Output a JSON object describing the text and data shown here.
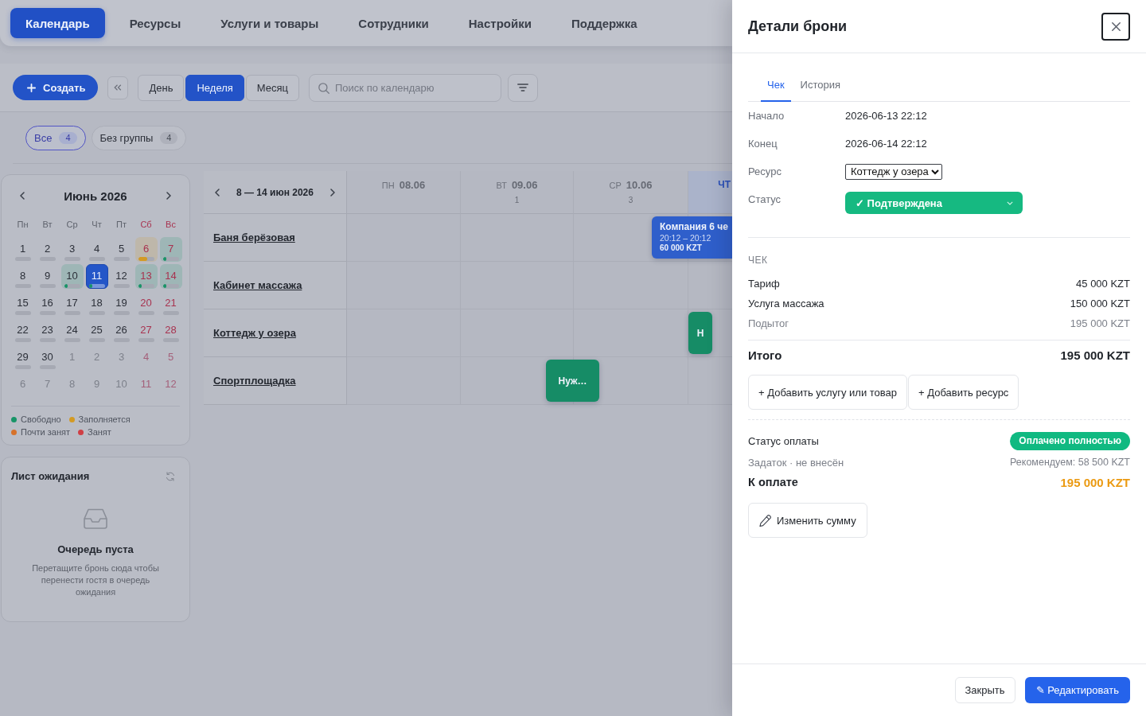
{
  "nav": {
    "tabs": [
      {
        "label": "Календарь",
        "selected": true
      },
      {
        "label": "Ресурсы",
        "selected": false
      },
      {
        "label": "Услуги и товары",
        "selected": false
      },
      {
        "label": "Сотрудники",
        "selected": false
      },
      {
        "label": "Настройки",
        "selected": false
      },
      {
        "label": "Поддержка",
        "selected": false
      }
    ]
  },
  "toolbar": {
    "create_button": "Создать",
    "views": [
      {
        "label": "День",
        "selected": false
      },
      {
        "label": "Неделя",
        "selected": true
      },
      {
        "label": "Месяц",
        "selected": false
      }
    ],
    "search": {
      "placeholder": "Поиск по календарю"
    }
  },
  "groups": [
    {
      "label": "Все",
      "count": "4",
      "selected": true
    },
    {
      "label": "Без группы",
      "count": "4",
      "selected": false
    }
  ],
  "mini_calendar": {
    "title": "Июнь 2026",
    "weekdays": [
      "Пн",
      "Вт",
      "Ср",
      "Чт",
      "Пт",
      "Сб",
      "Вс"
    ],
    "days": [
      {
        "label": "1",
        "in_month": true,
        "selected": false
      },
      {
        "label": "2",
        "in_month": true,
        "selected": false
      },
      {
        "label": "3",
        "in_month": true,
        "selected": false
      },
      {
        "label": "4",
        "in_month": true,
        "selected": false
      },
      {
        "label": "5",
        "in_month": true,
        "selected": false
      },
      {
        "label": "6",
        "in_month": true,
        "selected": false,
        "level": 0.55,
        "color": "#d39a23"
      },
      {
        "label": "7",
        "in_month": true,
        "selected": false,
        "level": 0.2,
        "color": "#179467"
      },
      {
        "label": "8",
        "in_month": true,
        "selected": false
      },
      {
        "label": "9",
        "in_month": true,
        "selected": false
      },
      {
        "label": "10",
        "in_month": true,
        "selected": false,
        "level": 0.2,
        "color": "#179467"
      },
      {
        "label": "11",
        "in_month": true,
        "selected": true,
        "level": 0.2,
        "color": "#179467"
      },
      {
        "label": "12",
        "in_month": true,
        "selected": false
      },
      {
        "label": "13",
        "in_month": true,
        "selected": false,
        "level": 0.2,
        "color": "#179467"
      },
      {
        "label": "14",
        "in_month": true,
        "selected": false,
        "level": 0.2,
        "color": "#179467"
      },
      {
        "label": "15",
        "in_month": true,
        "selected": false
      },
      {
        "label": "16",
        "in_month": true,
        "selected": false
      },
      {
        "label": "17",
        "in_month": true,
        "selected": false
      },
      {
        "label": "18",
        "in_month": true,
        "selected": false
      },
      {
        "label": "19",
        "in_month": true,
        "selected": false
      },
      {
        "label": "20",
        "in_month": true,
        "selected": false
      },
      {
        "label": "21",
        "in_month": true,
        "selected": false
      },
      {
        "label": "22",
        "in_month": true,
        "selected": false
      },
      {
        "label": "23",
        "in_month": true,
        "selected": false
      },
      {
        "label": "24",
        "in_month": true,
        "selected": false
      },
      {
        "label": "25",
        "in_month": true,
        "selected": false
      },
      {
        "label": "26",
        "in_month": true,
        "selected": false
      },
      {
        "label": "27",
        "in_month": true,
        "selected": false
      },
      {
        "label": "28",
        "in_month": true,
        "selected": false
      },
      {
        "label": "29",
        "in_month": true,
        "selected": false
      },
      {
        "label": "30",
        "in_month": true,
        "selected": false
      },
      {
        "label": "1",
        "in_month": false,
        "selected": false
      },
      {
        "label": "2",
        "in_month": false,
        "selected": false
      },
      {
        "label": "3",
        "in_month": false,
        "selected": false
      },
      {
        "label": "4",
        "in_month": false,
        "selected": false
      },
      {
        "label": "5",
        "in_month": false,
        "selected": false
      },
      {
        "label": "6",
        "in_month": false,
        "selected": false
      },
      {
        "label": "7",
        "in_month": false,
        "selected": false
      },
      {
        "label": "8",
        "in_month": false,
        "selected": false
      },
      {
        "label": "9",
        "in_month": false,
        "selected": false
      },
      {
        "label": "10",
        "in_month": false,
        "selected": false
      },
      {
        "label": "11",
        "in_month": false,
        "selected": false
      },
      {
        "label": "12",
        "in_month": false,
        "selected": false
      }
    ],
    "legend": [
      {
        "label": "Свободно",
        "color": "#179467"
      },
      {
        "label": "Заполняется",
        "color": "#d39a23"
      },
      {
        "label": "Почти занят",
        "color": "#d6722b"
      },
      {
        "label": "Занят",
        "color": "#cf3f45"
      }
    ]
  },
  "waitlist": {
    "title": "Лист ожидания",
    "empty_title": "Очередь пуста",
    "empty_text": "Перетащите бронь сюда чтобы перенести гостя в очередь ожидания"
  },
  "week": {
    "range": "8 — 14 июн 2026",
    "days": [
      {
        "weekday": "ПН",
        "date": "08.06",
        "today": false
      },
      {
        "weekday": "ВТ",
        "date": "09.06",
        "count": "1",
        "today": false
      },
      {
        "weekday": "СР",
        "date": "10.06",
        "count": "3",
        "today": false
      },
      {
        "weekday": "ЧТ",
        "today": true
      }
    ],
    "resources": [
      {
        "name": "Баня берёзовая",
        "bookings": [
          {
            "title": "Компания 6 че",
            "time": "20:12 – 20:12",
            "price": "60 000 KZT",
            "color": "#2f5fcb"
          }
        ]
      },
      {
        "name": "Кабинет массажа"
      },
      {
        "name": "Коттедж у озера",
        "bookings": [
          {
            "title": "Н",
            "color": "#168c66"
          }
        ]
      },
      {
        "name": "Спортплощадка",
        "bookings": [
          {
            "title": "Нуж…",
            "color": "#168c66"
          }
        ]
      }
    ]
  },
  "drawer": {
    "title": "Детали брони",
    "tabs": [
      {
        "label": "Чек",
        "selected": true
      },
      {
        "label": "История",
        "selected": false
      }
    ],
    "fields": [
      {
        "kind": "text",
        "label": "Начало",
        "value": "2026-06-13 22:12"
      },
      {
        "kind": "text",
        "label": "Конец",
        "value": "2026-06-14 22:12"
      },
      {
        "kind": "select",
        "label": "Ресурс",
        "value": "Коттедж у озера"
      },
      {
        "kind": "status",
        "label": "Статус",
        "value": "✓ Подтверждена"
      }
    ],
    "receipt": {
      "heading": "ЧЕК",
      "lines": [
        {
          "kind": "item",
          "label": "Тариф",
          "amount": "45 000 KZT"
        },
        {
          "kind": "item",
          "label": "Услуга массажа",
          "amount": "150 000 KZT"
        },
        {
          "kind": "subtotal",
          "label": "Подытог",
          "amount": "195 000 KZT"
        }
      ],
      "total": {
        "label": "Итого",
        "amount": "195 000 KZT"
      },
      "actions": [
        "+ Добавить услугу или товар",
        "+ Добавить ресурс"
      ]
    },
    "payment": {
      "status_label": "Статус оплаты",
      "status_badge": "Оплачено полностью",
      "deposit": "Задаток · не внесён",
      "recommended": "Рекомендуем: 58 500 KZT",
      "due_label": "К оплате",
      "due_amount": "195 000 KZT",
      "edit_button": "Изменить сумму"
    },
    "footer": {
      "close_button": "Закрыть",
      "edit_button": "✎ Редактировать"
    }
  }
}
